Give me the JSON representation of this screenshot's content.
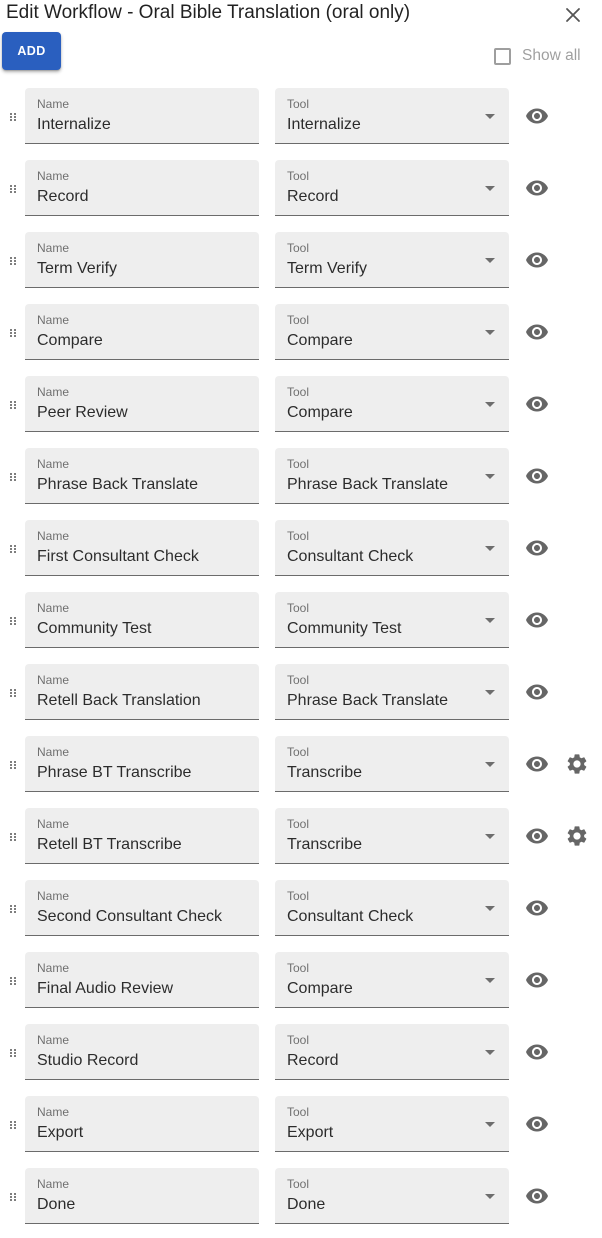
{
  "dialog": {
    "title": "Edit Workflow - Oral Bible Translation (oral only)",
    "close_icon": "close-icon"
  },
  "toolbar": {
    "add_label": "ADD",
    "show_all_label": "Show all",
    "show_all_checked": false
  },
  "colors": {
    "primary": "#2a5fbf",
    "field_bg": "#eeeeee",
    "icon": "#666666"
  },
  "steps": [
    {
      "name_label": "Name",
      "name": "Internalize",
      "tool_label": "Tool",
      "tool": "Internalize",
      "has_settings": false
    },
    {
      "name_label": "Name",
      "name": "Record",
      "tool_label": "Tool",
      "tool": "Record",
      "has_settings": false
    },
    {
      "name_label": "Name",
      "name": "Term Verify",
      "tool_label": "Tool",
      "tool": "Term Verify",
      "has_settings": false
    },
    {
      "name_label": "Name",
      "name": "Compare",
      "tool_label": "Tool",
      "tool": "Compare",
      "has_settings": false
    },
    {
      "name_label": "Name",
      "name": "Peer Review",
      "tool_label": "Tool",
      "tool": "Compare",
      "has_settings": false
    },
    {
      "name_label": "Name",
      "name": "Phrase Back Translate",
      "tool_label": "Tool",
      "tool": "Phrase Back Translate",
      "has_settings": false
    },
    {
      "name_label": "Name",
      "name": "First Consultant Check",
      "tool_label": "Tool",
      "tool": "Consultant Check",
      "has_settings": false
    },
    {
      "name_label": "Name",
      "name": "Community Test",
      "tool_label": "Tool",
      "tool": "Community Test",
      "has_settings": false
    },
    {
      "name_label": "Name",
      "name": "Retell Back Translation",
      "tool_label": "Tool",
      "tool": "Phrase Back Translate",
      "has_settings": false
    },
    {
      "name_label": "Name",
      "name": "Phrase BT Transcribe",
      "tool_label": "Tool",
      "tool": "Transcribe",
      "has_settings": true
    },
    {
      "name_label": "Name",
      "name": "Retell BT Transcribe",
      "tool_label": "Tool",
      "tool": "Transcribe",
      "has_settings": true
    },
    {
      "name_label": "Name",
      "name": "Second Consultant Check",
      "tool_label": "Tool",
      "tool": "Consultant Check",
      "has_settings": false
    },
    {
      "name_label": "Name",
      "name": "Final Audio Review",
      "tool_label": "Tool",
      "tool": "Compare",
      "has_settings": false
    },
    {
      "name_label": "Name",
      "name": "Studio Record",
      "tool_label": "Tool",
      "tool": "Record",
      "has_settings": false
    },
    {
      "name_label": "Name",
      "name": "Export",
      "tool_label": "Tool",
      "tool": "Export",
      "has_settings": false
    },
    {
      "name_label": "Name",
      "name": "Done",
      "tool_label": "Tool",
      "tool": "Done",
      "has_settings": false
    }
  ]
}
